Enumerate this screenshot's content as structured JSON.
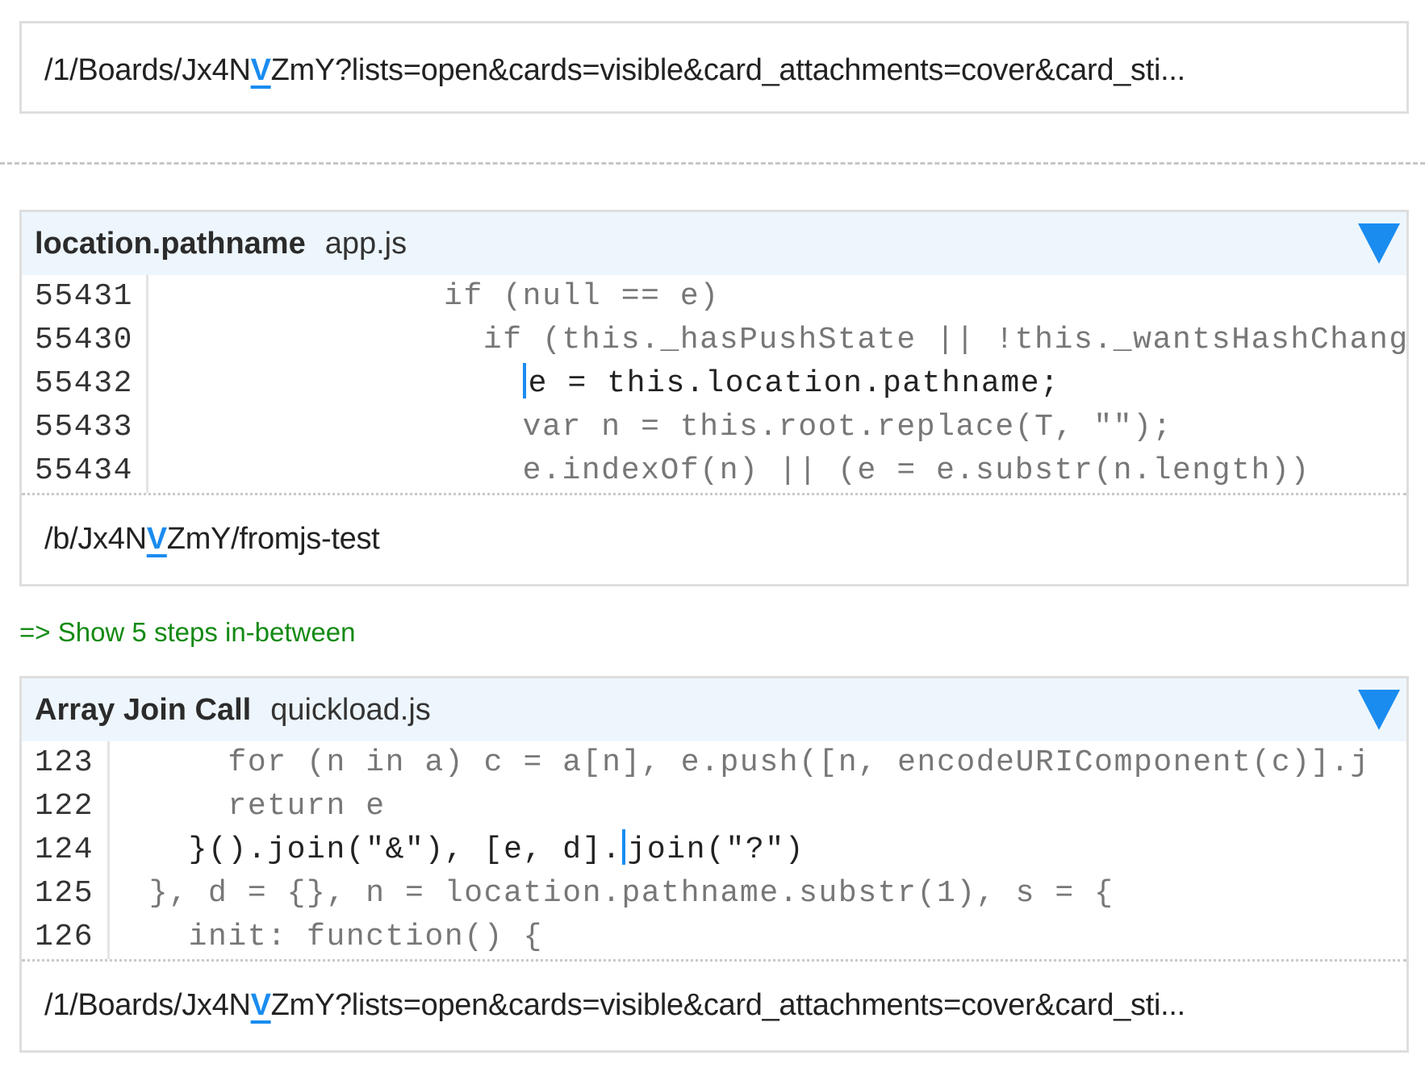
{
  "top_value": {
    "before": "/1/Boards/Jx4N",
    "highlight": "V",
    "after": "ZmY?lists=open&cards=visible&card_attachments=cover&card_sti..."
  },
  "steps": [
    {
      "operation": "location.pathname",
      "file": "app.js",
      "toggle_icon": "triangle-down-icon",
      "code_lines": [
        {
          "line_no": "55431",
          "pre": "               if (null == e)",
          "post": ""
        },
        {
          "line_no": "55430",
          "pre": "                 if (this._hasPushState || !this._wantsHashChange",
          "post": ""
        },
        {
          "line_no": "55432",
          "pre": "                   ",
          "post": "e = this.location.pathname;"
        },
        {
          "line_no": "55433",
          "pre": "                   var n = this.root.replace(T, \"\");",
          "post": ""
        },
        {
          "line_no": "55434",
          "pre": "                   e.indexOf(n) || (e = e.substr(n.length))",
          "post": ""
        }
      ],
      "current_line": 2,
      "value": {
        "before": "/b/Jx4N",
        "highlight": "V",
        "after": "ZmY/fromjs-test"
      }
    },
    {
      "operation": "Array Join Call",
      "file": "quickload.js",
      "toggle_icon": "triangle-down-icon",
      "code_lines": [
        {
          "line_no": "123",
          "pre": "      for (n in a) c = a[n], e.push([n, encodeURIComponent(c)].j",
          "post": ""
        },
        {
          "line_no": "122",
          "pre": "      return e",
          "post": ""
        },
        {
          "line_no": "124",
          "pre": "    }().join(\"&\"), [e, d].",
          "post": "join(\"?\")"
        },
        {
          "line_no": "125",
          "pre": "  }, d = {}, n = location.pathname.substr(1), s = {",
          "post": ""
        },
        {
          "line_no": "126",
          "pre": "    init: function() {",
          "post": ""
        }
      ],
      "current_line": 2,
      "value": {
        "before": "/1/Boards/Jx4N",
        "highlight": "V",
        "after": "ZmY?lists=open&cards=visible&card_attachments=cover&card_sti..."
      }
    }
  ],
  "show_steps_link": "=> Show 5 steps in-between",
  "colors": {
    "accent": "#1a8cf0",
    "header_bg": "#eef6fd",
    "link": "#138a13",
    "border": "#dedede"
  }
}
